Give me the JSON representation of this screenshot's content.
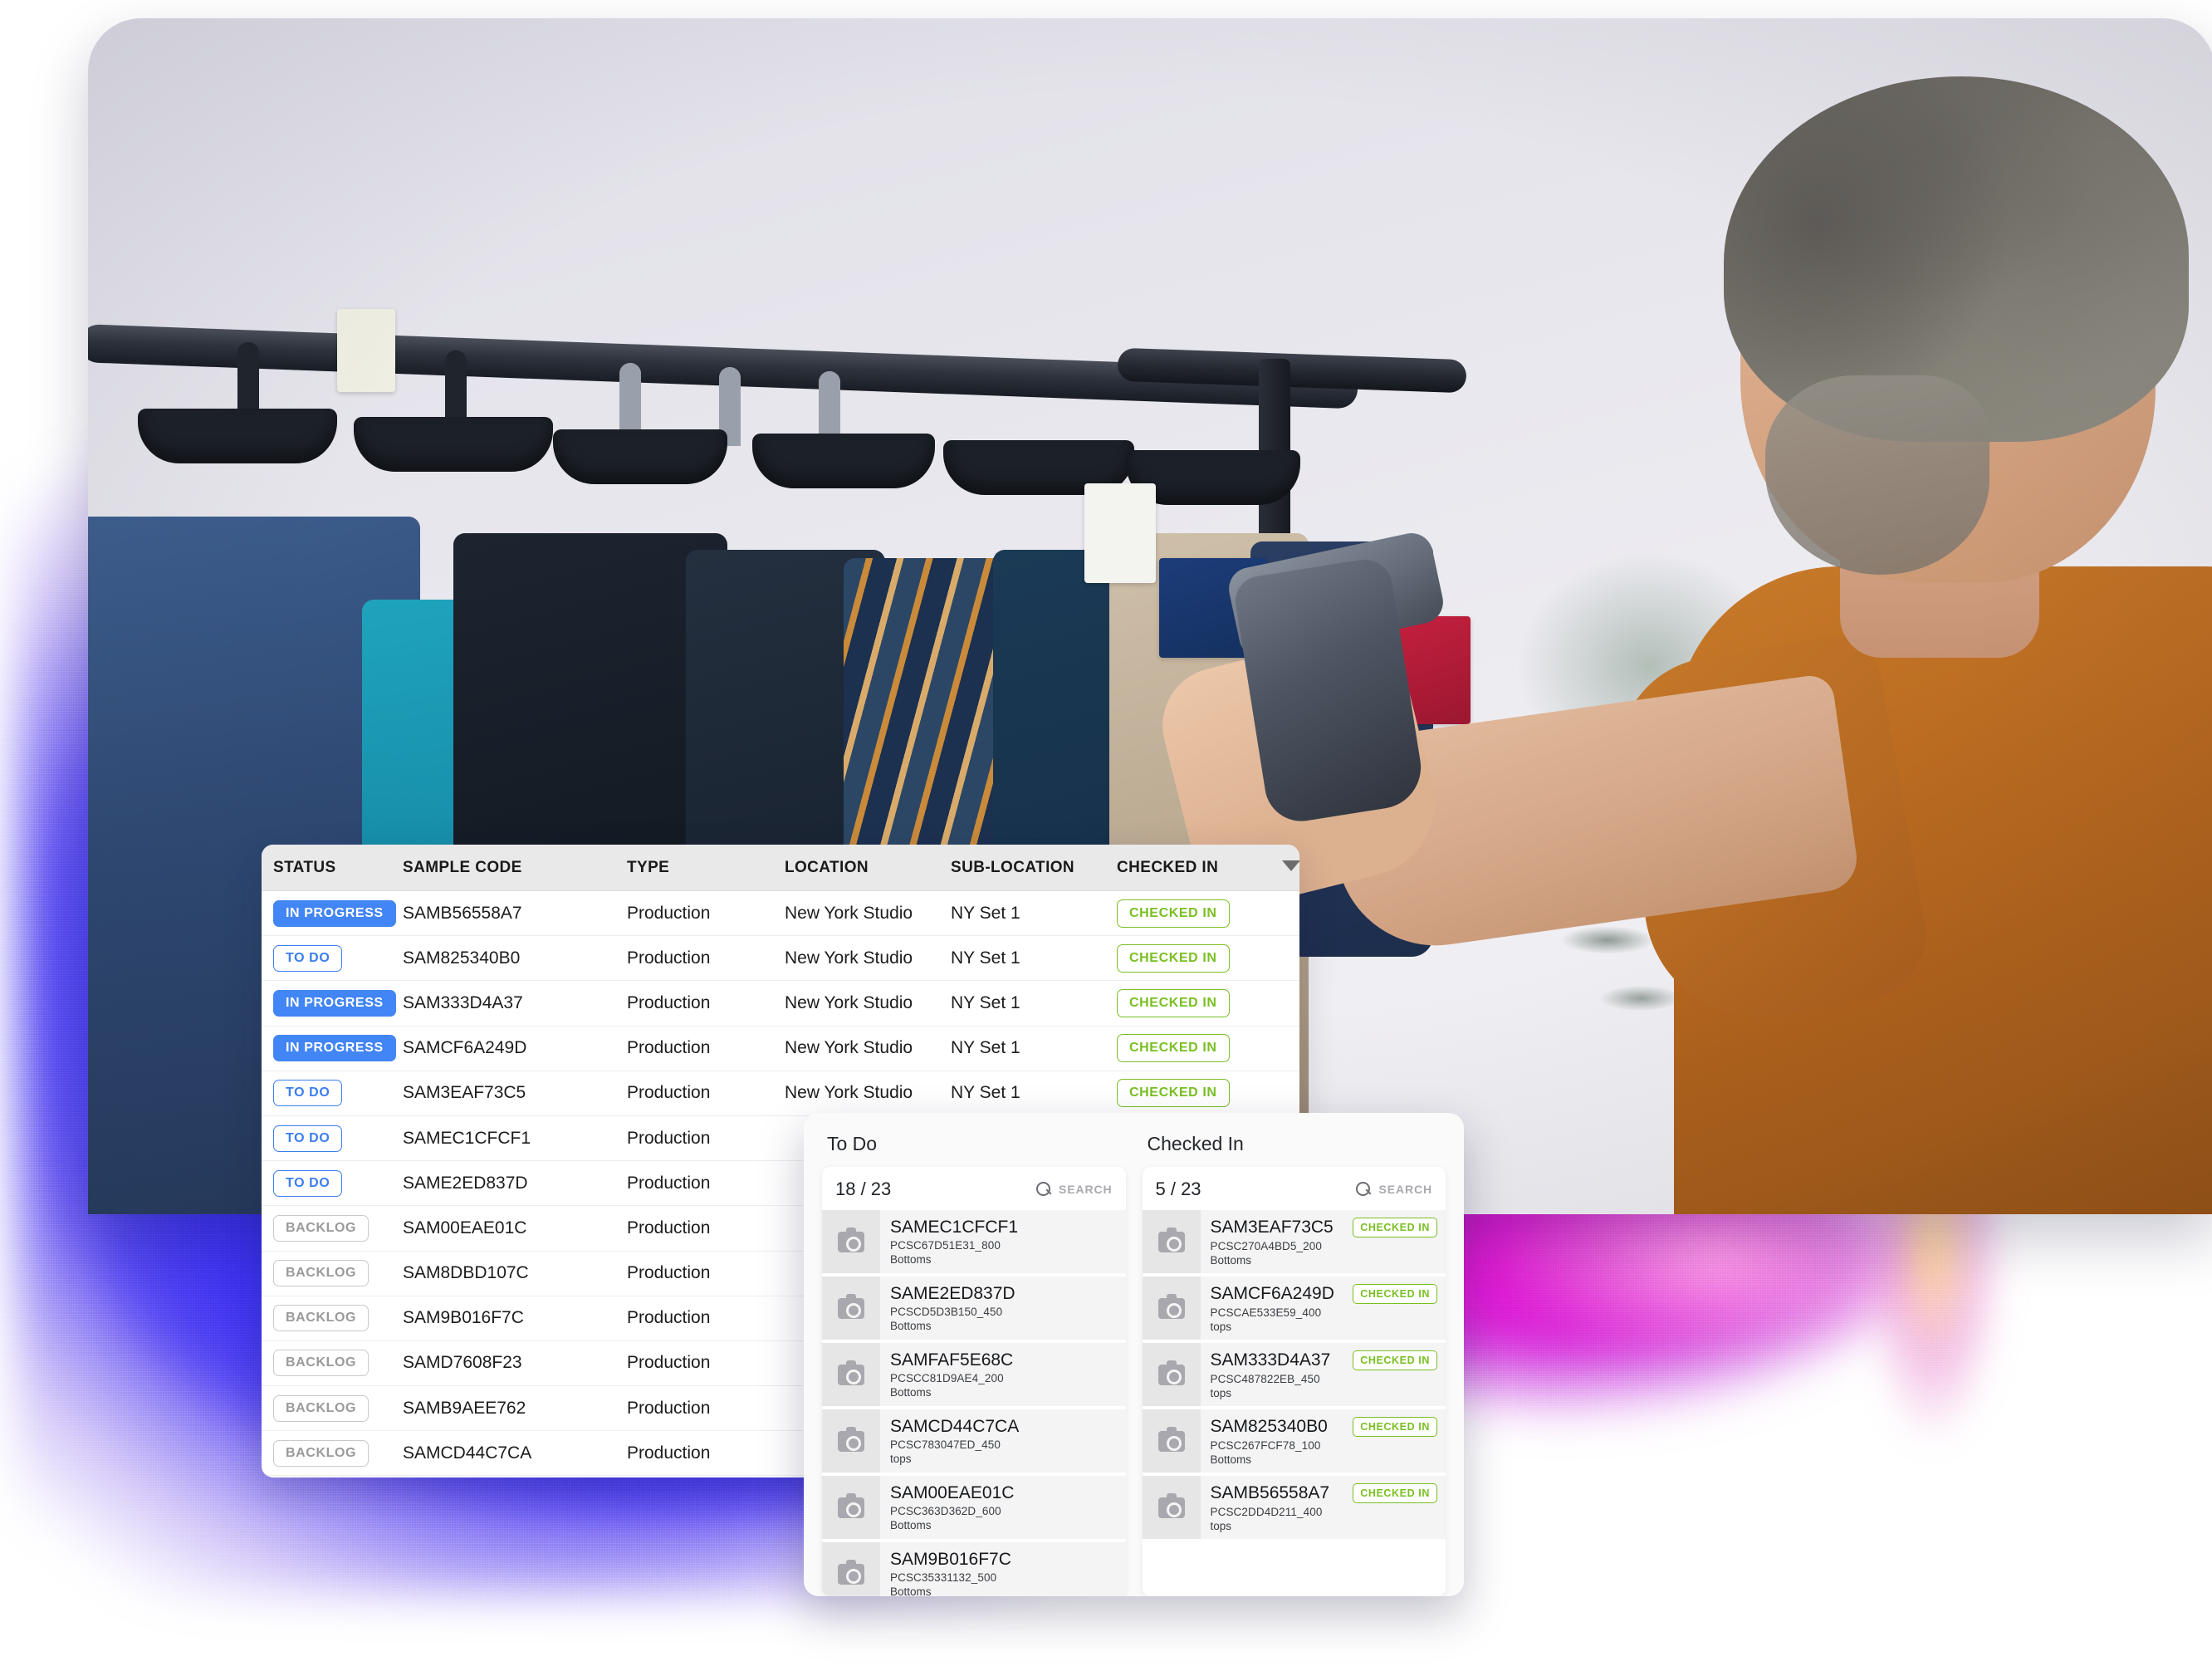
{
  "table": {
    "columns": [
      "STATUS",
      "SAMPLE CODE",
      "TYPE",
      "LOCATION",
      "SUB-LOCATION",
      "CHECKED IN"
    ],
    "sort_icon": "chevron-down-icon",
    "rows": [
      {
        "status": "IN PROGRESS",
        "status_kind": "inprogress",
        "code": "SAMB56558A7",
        "type": "Production",
        "location": "New York Studio",
        "sublocation": "NY Set 1",
        "checked_in": "CHECKED IN"
      },
      {
        "status": "TO DO",
        "status_kind": "todo",
        "code": "SAM825340B0",
        "type": "Production",
        "location": "New York Studio",
        "sublocation": "NY Set 1",
        "checked_in": "CHECKED IN"
      },
      {
        "status": "IN PROGRESS",
        "status_kind": "inprogress",
        "code": "SAM333D4A37",
        "type": "Production",
        "location": "New York Studio",
        "sublocation": "NY Set 1",
        "checked_in": "CHECKED IN"
      },
      {
        "status": "IN PROGRESS",
        "status_kind": "inprogress",
        "code": "SAMCF6A249D",
        "type": "Production",
        "location": "New York Studio",
        "sublocation": "NY Set 1",
        "checked_in": "CHECKED IN"
      },
      {
        "status": "TO DO",
        "status_kind": "todo",
        "code": "SAM3EAF73C5",
        "type": "Production",
        "location": "New York Studio",
        "sublocation": "NY Set 1",
        "checked_in": "CHECKED IN"
      },
      {
        "status": "TO DO",
        "status_kind": "todo",
        "code": "SAMEC1CFCF1",
        "type": "Production",
        "location": "",
        "sublocation": "",
        "checked_in": ""
      },
      {
        "status": "TO DO",
        "status_kind": "todo",
        "code": "SAME2ED837D",
        "type": "Production",
        "location": "",
        "sublocation": "",
        "checked_in": ""
      },
      {
        "status": "BACKLOG",
        "status_kind": "backlog",
        "code": "SAM00EAE01C",
        "type": "Production",
        "location": "",
        "sublocation": "",
        "checked_in": ""
      },
      {
        "status": "BACKLOG",
        "status_kind": "backlog",
        "code": "SAM8DBD107C",
        "type": "Production",
        "location": "",
        "sublocation": "",
        "checked_in": ""
      },
      {
        "status": "BACKLOG",
        "status_kind": "backlog",
        "code": "SAM9B016F7C",
        "type": "Production",
        "location": "",
        "sublocation": "",
        "checked_in": ""
      },
      {
        "status": "BACKLOG",
        "status_kind": "backlog",
        "code": "SAMD7608F23",
        "type": "Production",
        "location": "",
        "sublocation": "",
        "checked_in": ""
      },
      {
        "status": "BACKLOG",
        "status_kind": "backlog",
        "code": "SAMB9AEE762",
        "type": "Production",
        "location": "",
        "sublocation": "",
        "checked_in": ""
      },
      {
        "status": "BACKLOG",
        "status_kind": "backlog",
        "code": "SAMCD44C7CA",
        "type": "Production",
        "location": "",
        "sublocation": "",
        "checked_in": ""
      }
    ]
  },
  "kanban": {
    "columns": [
      {
        "title": "To Do",
        "count": "18 / 23",
        "search_label": "SEARCH",
        "search_icon": "search-icon",
        "items": [
          {
            "code": "SAMEC1CFCF1",
            "sku": "PCSC67D51E31_800",
            "category": "Bottoms",
            "badge": ""
          },
          {
            "code": "SAME2ED837D",
            "sku": "PCSCD5D3B150_450",
            "category": "Bottoms",
            "badge": ""
          },
          {
            "code": "SAMFAF5E68C",
            "sku": "PCSCC81D9AE4_200",
            "category": "Bottoms",
            "badge": ""
          },
          {
            "code": "SAMCD44C7CA",
            "sku": "PCSC783047ED_450",
            "category": "tops",
            "badge": ""
          },
          {
            "code": "SAM00EAE01C",
            "sku": "PCSC363D362D_600",
            "category": "Bottoms",
            "badge": ""
          },
          {
            "code": "SAM9B016F7C",
            "sku": "PCSC35331132_500",
            "category": "Bottoms",
            "badge": ""
          }
        ]
      },
      {
        "title": "Checked In",
        "count": "5 / 23",
        "search_label": "SEARCH",
        "search_icon": "search-icon",
        "items": [
          {
            "code": "SAM3EAF73C5",
            "sku": "PCSC270A4BD5_200",
            "category": "Bottoms",
            "badge": "CHECKED IN"
          },
          {
            "code": "SAMCF6A249D",
            "sku": "PCSCAE533E59_400",
            "category": "tops",
            "badge": "CHECKED IN"
          },
          {
            "code": "SAM333D4A37",
            "sku": "PCSC487822EB_450",
            "category": "tops",
            "badge": "CHECKED IN"
          },
          {
            "code": "SAM825340B0",
            "sku": "PCSC267FCF78_100",
            "category": "Bottoms",
            "badge": "CHECKED IN"
          },
          {
            "code": "SAMB56558A7",
            "sku": "PCSC2DD4D211_400",
            "category": "tops",
            "badge": "CHECKED IN"
          }
        ]
      }
    ]
  },
  "colors": {
    "in_progress": "#4285f4",
    "to_do": "#3b7ef0",
    "backlog": "#9a9a9a",
    "checked_in": "#79bf22",
    "glow_blue": "#2727ee",
    "glow_magenta": "#e21ad0"
  },
  "photo": {
    "description": "person-scanning-garment-rack"
  }
}
